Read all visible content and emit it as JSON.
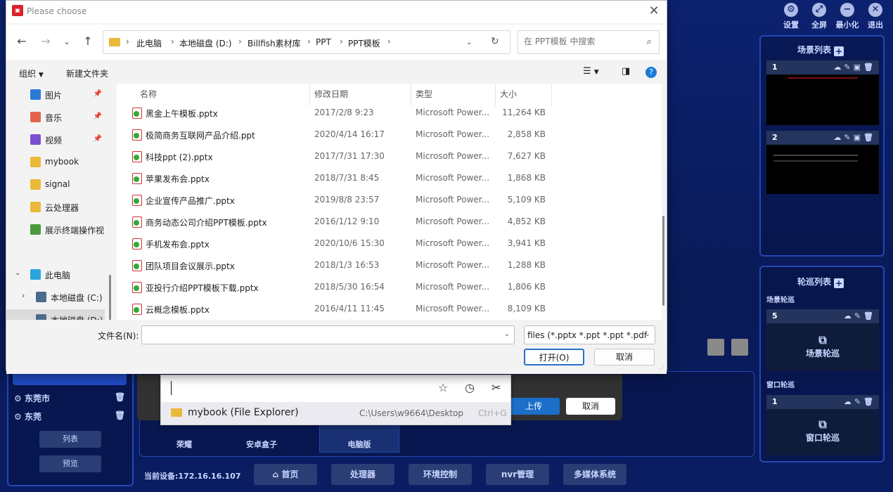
{
  "app": {
    "top_controls": [
      "设置",
      "全屏",
      "最小化",
      "退出"
    ],
    "scene_list": {
      "title": "场景列表",
      "cards": [
        {
          "index": "1"
        },
        {
          "index": "2"
        }
      ]
    },
    "tour_list": {
      "title": "轮巡列表",
      "scene_tour_label": "场景轮巡",
      "scene_tour_card": {
        "index": "5",
        "label": "场景轮巡"
      },
      "window_tour_label": "窗口轮巡",
      "window_tour_card": {
        "index": "1",
        "label": "窗口轮巡"
      }
    },
    "left_panel": {
      "items": [
        "东莞市",
        "东莞"
      ],
      "btn_list": "列表",
      "btn_preview": "预览"
    },
    "device_tabs": [
      "荣耀",
      "安卓盒子",
      "电脑版"
    ],
    "partial_label": "多",
    "current_device": "当前设备:172.16.16.107",
    "bottom_nav": [
      "首页",
      "处理器",
      "环境控制",
      "nvr管理",
      "多媒体系统"
    ],
    "upload_dialog": {
      "upload_label": "上传",
      "cancel_label": "取消"
    }
  },
  "dialog": {
    "title": "Please choose",
    "address": {
      "crumbs": [
        "此电脑",
        "本地磁盘 (D:)",
        "Billfish素材库",
        "PPT",
        "PPT模板"
      ]
    },
    "search_placeholder": "在 PPT模板 中搜索",
    "toolbar": {
      "organize": "组织",
      "new_folder": "新建文件夹"
    },
    "nav_items": [
      {
        "label": "图片",
        "pinned": true,
        "color": "#2b79d6"
      },
      {
        "label": "音乐",
        "pinned": true,
        "color": "#e5634c"
      },
      {
        "label": "视频",
        "pinned": true,
        "color": "#7b4fd1"
      },
      {
        "label": "mybook",
        "pinned": false,
        "color": "#e9b93a"
      },
      {
        "label": "signal",
        "pinned": false,
        "color": "#e9b93a"
      },
      {
        "label": "云处理器",
        "pinned": false,
        "color": "#e9b93a"
      },
      {
        "label": "展示终端操作视",
        "pinned": false,
        "color": "#4a9a3c"
      },
      {
        "label": "此电脑",
        "pinned": false,
        "color": "#2aa5dc"
      },
      {
        "label": "本地磁盘 (C:)",
        "pinned": false,
        "color": "#4a6b8c"
      },
      {
        "label": "本地磁盘 (D:)",
        "pinned": false,
        "color": "#4a6b8c"
      }
    ],
    "columns": {
      "name": "名称",
      "date": "修改日期",
      "type": "类型",
      "size": "大小"
    },
    "files": [
      {
        "name": "黑金上午模板.pptx",
        "date": "2017/2/8 9:23",
        "type": "Microsoft Power...",
        "size": "11,264 KB"
      },
      {
        "name": "极简商务互联网产品介绍.ppt",
        "date": "2020/4/14 16:17",
        "type": "Microsoft Power...",
        "size": "2,858 KB"
      },
      {
        "name": "科技ppt (2).pptx",
        "date": "2017/7/31 17:30",
        "type": "Microsoft Power...",
        "size": "7,627 KB"
      },
      {
        "name": "苹果发布会.pptx",
        "date": "2018/7/31 8:45",
        "type": "Microsoft Power...",
        "size": "1,868 KB"
      },
      {
        "name": "企业宣传产品推广.pptx",
        "date": "2019/8/8 23:57",
        "type": "Microsoft Power...",
        "size": "5,109 KB"
      },
      {
        "name": "商务动态公司介绍PPT模板.pptx",
        "date": "2016/1/12 9:10",
        "type": "Microsoft Power...",
        "size": "4,852 KB"
      },
      {
        "name": "手机发布会.pptx",
        "date": "2020/10/6 15:30",
        "type": "Microsoft Power...",
        "size": "3,941 KB"
      },
      {
        "name": "团队项目会议展示.pptx",
        "date": "2018/1/3 16:53",
        "type": "Microsoft Power...",
        "size": "1,288 KB"
      },
      {
        "name": "亚投行介绍PPT模板下载.pptx",
        "date": "2018/5/30 16:54",
        "type": "Microsoft Power...",
        "size": "1,806 KB"
      },
      {
        "name": "云概念模板.pptx",
        "date": "2016/4/11 11:45",
        "type": "Microsoft Power...",
        "size": "8,109 KB"
      }
    ],
    "filename_label": "文件名(N):",
    "filename_value": "",
    "filter_value": "files (*.pptx *.ppt *.ppt *.pdf",
    "open_label": "打开(O)",
    "cancel_label": "取消"
  },
  "autocomplete": {
    "item_name": "mybook (File Explorer)",
    "item_path": "C:\\Users\\w9664\\Desktop",
    "item_shortcut": "Ctrl+G"
  }
}
